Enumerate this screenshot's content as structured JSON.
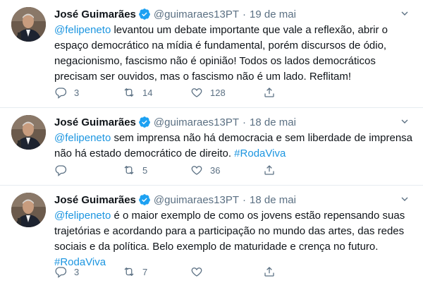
{
  "tweets": [
    {
      "name": "José Guimarães",
      "handle": "@guimaraes13PT",
      "separator": "·",
      "date": "19 de mai",
      "lines": [
        [
          {
            "t": "@felipeneto",
            "link": true
          },
          {
            "t": " levantou um debate importante que vale a reflexão, abrir o"
          }
        ],
        [
          {
            "t": "espaço democrático na mídia é fundamental, porém discursos de ódio,"
          }
        ],
        [
          {
            "t": "negacionismo, fascismo não é opinião! Todos os lados democráticos"
          }
        ],
        [
          {
            "t": "precisam ser ouvidos, mas o fascismo não é um lado. Reflitam!"
          }
        ]
      ],
      "replies": "3",
      "retweets": "14",
      "likes": "128"
    },
    {
      "name": "José Guimarães",
      "handle": "@guimaraes13PT",
      "separator": "·",
      "date": "18 de mai",
      "lines": [
        [
          {
            "t": "@felipeneto",
            "link": true
          },
          {
            "t": " sem imprensa não há democracia e sem liberdade de imprensa"
          }
        ],
        [
          {
            "t": "não há estado democrático de direito. "
          },
          {
            "t": "#RodaViva",
            "link": true
          }
        ]
      ],
      "replies": "",
      "retweets": "5",
      "likes": "36"
    },
    {
      "name": "José Guimarães",
      "handle": "@guimaraes13PT",
      "separator": "·",
      "date": "18 de mai",
      "lines": [
        [
          {
            "t": "@felipeneto",
            "link": true
          },
          {
            "t": " é o maior exemplo de como os jovens estão repensando suas"
          }
        ],
        [
          {
            "t": "trajetórias e acordando para a participação no mundo das artes, das redes"
          }
        ],
        [
          {
            "t": "sociais e da política. Belo exemplo de maturidade e crença no futuro."
          }
        ],
        [
          {
            "t": "#RodaViva",
            "link": true
          }
        ]
      ],
      "replies": "3",
      "retweets": "7",
      "likes": ""
    }
  ],
  "icons": {
    "verified": "verified-badge-icon",
    "caret": "chevron-down-icon",
    "reply": "reply-icon",
    "retweet": "retweet-icon",
    "like": "heart-icon",
    "share": "share-icon"
  },
  "colors": {
    "link": "#1b95e0",
    "secondary": "#5b7083",
    "verified": "#1da1f2",
    "divider": "#e6ecf0"
  }
}
